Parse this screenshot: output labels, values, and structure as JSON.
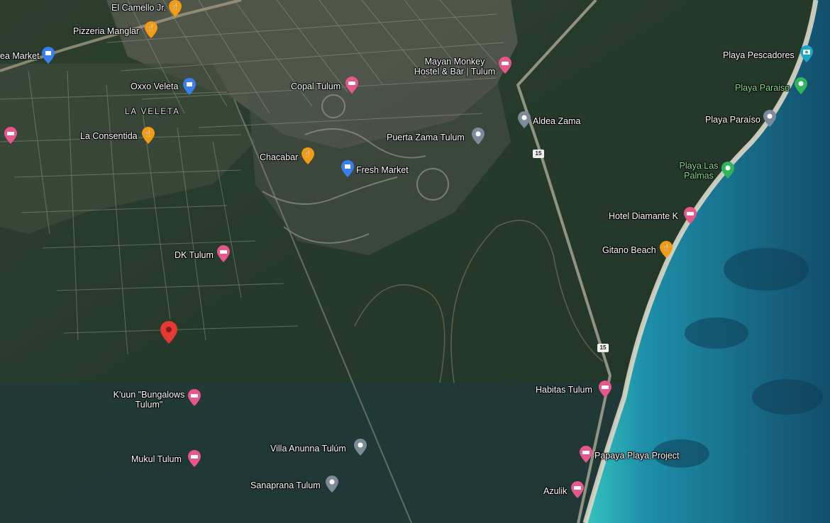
{
  "labels": {
    "el_camello": "El Camello Jr.",
    "pizzeria": "Pizzeria Manglar",
    "market_left": "ea Market",
    "oxxo": "Oxxo Veleta",
    "la_veleta": "LA VELETA",
    "la_consentida": "La Consentida",
    "copal": "Copal Tulum",
    "mayan_monkey_1": "Mayan Monkey",
    "mayan_monkey_2": "Hostel & Bar | Tulum",
    "puerta_zama": "Puerta Zama Tulum",
    "aldea_zama": "Aldea Zama",
    "chacabar": "Chacabar",
    "fresh_market": "Fresh Market",
    "dk_tulum": "DK Tulum",
    "kuun_1": "K'uun \"Bungalows",
    "kuun_2": "Tulum\"",
    "mukul": "Mukul Tulum",
    "villa_anunna": "Villa Anunna Tulúm",
    "sanaprana": "Sanaprana Tulum",
    "playa_pescadores": "Playa Pescadores",
    "playa_paraiso_park": "Playa Paraiso",
    "playa_paraiso": "Playa Paraíso",
    "playa_las_palmas_1": "Playa Las",
    "playa_las_palmas_2": "Palmas",
    "hotel_diamante": "Hotel Diamante K",
    "gitano_beach": "Gitano Beach",
    "habitas": "Habitas Tulum",
    "papaya_playa": "Papaya Playa Project",
    "azulik": "Azulik"
  },
  "route_shields": {
    "shield_upper": "15",
    "shield_lower": "15"
  },
  "colors": {
    "forest": "#24392a",
    "ocean_deep": "#0f4f6e",
    "ocean_shallow": "#2fb3b8",
    "beach": "#d9d6c6",
    "town": "#6f6e62",
    "pin_food": "#f39c12",
    "pin_hotel": "#e8578a",
    "pin_shop": "#3a7ff0",
    "pin_generic": "#7d8a99",
    "pin_park": "#2fb55b",
    "pin_selected": "#e53935"
  }
}
